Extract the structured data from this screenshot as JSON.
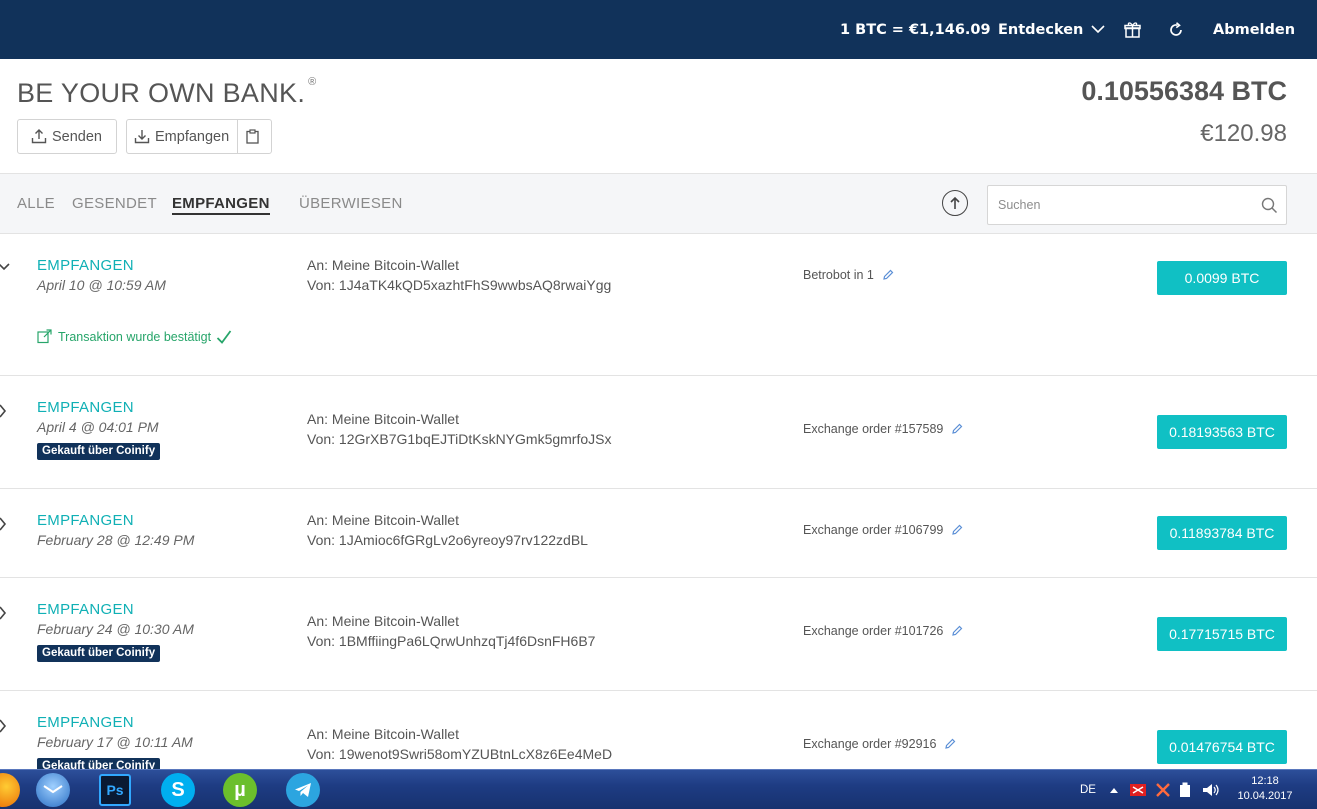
{
  "nav": {
    "rate": "1 BTC =  €1,146.09",
    "explore": "Entdecken",
    "logout": "Abmelden"
  },
  "header": {
    "brand": "BE YOUR OWN BANK.",
    "brand_mark": "®",
    "send": "Senden",
    "receive": "Empfangen",
    "balance_btc": "0.10556384 BTC",
    "balance_eur": "€120.98"
  },
  "filters": {
    "tabs": [
      "ALLE",
      "GESENDET",
      "EMPFANGEN",
      "ÜBERWIESEN"
    ],
    "active": "EMPFANGEN",
    "search_placeholder": "Suchen"
  },
  "transactions": [
    {
      "type": "EMPFANGEN",
      "date": "April 10 @ 10:59 AM",
      "to": "An: Meine Bitcoin-Wallet",
      "from": "Von: 1J4aTK4kQD5xazhtFhS9wwbsAQ8rwaiYgg",
      "note": "Betrobot in 1",
      "amount": "0.0099 BTC",
      "confirmation": "Transaktion wurde bestätigt",
      "expanded": true
    },
    {
      "type": "EMPFANGEN",
      "date": "April 4 @ 04:01 PM",
      "badge": "Gekauft über Coinify",
      "to": "An: Meine Bitcoin-Wallet",
      "from": "Von: 12GrXB7G1bqEJTiDtKskNYGmk5gmrfoJSx",
      "note": "Exchange order #157589",
      "amount": "0.18193563 BTC"
    },
    {
      "type": "EMPFANGEN",
      "date": "February 28 @ 12:49 PM",
      "to": "An: Meine Bitcoin-Wallet",
      "from": "Von: 1JAmioc6fGRgLv2o6yreoy97rv122zdBL",
      "note": "Exchange order #106799",
      "amount": "0.11893784 BTC"
    },
    {
      "type": "EMPFANGEN",
      "date": "February 24 @ 10:30 AM",
      "badge": "Gekauft über Coinify",
      "to": "An: Meine Bitcoin-Wallet",
      "from": "Von: 1BMffiingPa6LQrwUnhzqTj4f6DsnFH6B7",
      "note": "Exchange order #101726",
      "amount": "0.17715715 BTC"
    },
    {
      "type": "EMPFANGEN",
      "date": "February 17 @ 10:11 AM",
      "badge": "Gekauft über Coinify",
      "to": "An: Meine Bitcoin-Wallet",
      "from": "Von: 19wenot9Swri58omYZUBtnLcX8z6Ee4MeD",
      "note": "Exchange order #92916",
      "amount": "0.01476754 BTC"
    }
  ],
  "taskbar": {
    "apps": [
      "firefox-icon",
      "thunderbird-icon",
      "photoshop-icon",
      "skype-icon",
      "utorrent-icon",
      "telegram-icon"
    ],
    "lang": "DE",
    "time": "12:18",
    "date": "10.04.2017"
  },
  "colors": {
    "nav_bg": "#11325a",
    "accent": "#10c0c4",
    "type_text": "#10b0b5",
    "confirmed": "#27a56a"
  }
}
